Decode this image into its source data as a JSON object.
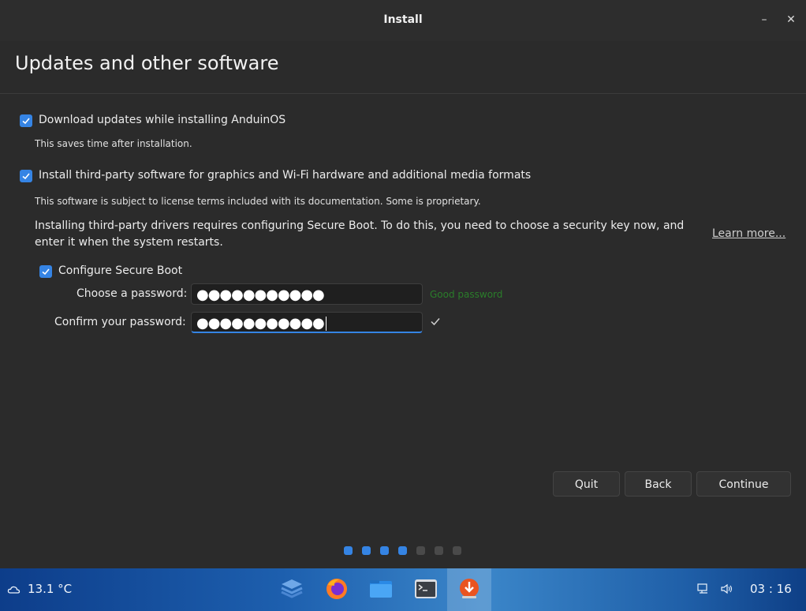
{
  "window": {
    "title": "Install",
    "minimize": "–",
    "close": "✕"
  },
  "page": {
    "heading": "Updates and other software"
  },
  "options": {
    "download_updates": {
      "label": "Download updates while installing AnduinOS",
      "description": "This saves time after installation.",
      "checked": true
    },
    "third_party": {
      "label": "Install third-party software for graphics and Wi-Fi hardware and additional media formats",
      "description": "This software is subject to license terms included with its documentation. Some is proprietary.",
      "checked": true
    },
    "secure_boot_info": "Installing third-party drivers requires configuring Secure Boot. To do this, you need to choose a security key now, and enter it when the system restarts.",
    "learn_more": "Learn more...",
    "configure_secure_boot": {
      "label": "Configure Secure Boot",
      "checked": true
    },
    "password": {
      "label": "Choose a password:",
      "value": "●●●●●●●●●●●",
      "strength": "Good password"
    },
    "confirm": {
      "label": "Confirm your password:",
      "value": "●●●●●●●●●●●"
    }
  },
  "buttons": {
    "quit": "Quit",
    "back": "Back",
    "continue": "Continue"
  },
  "progress": {
    "total_steps": 7,
    "completed_steps": 4,
    "active_color": "#3584e4",
    "inactive_color": "#4a4a4a"
  },
  "taskbar": {
    "weather": "13.1 °C",
    "clock": "03 : 16",
    "apps": [
      "stack-icon",
      "firefox-icon",
      "files-icon",
      "terminal-icon",
      "installer-icon"
    ]
  }
}
